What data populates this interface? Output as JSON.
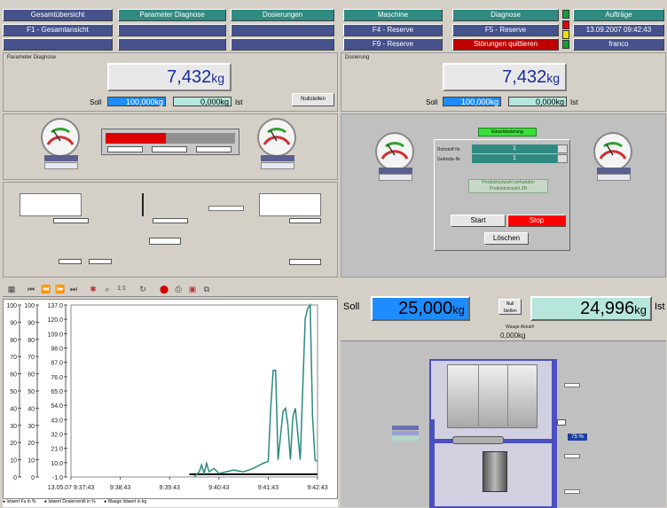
{
  "topnav": {
    "col1": [
      "Gesamtübersicht",
      "F1 - Gesamtansicht"
    ],
    "col2": [
      "Parameter Diagnose"
    ],
    "col3": [
      "Dosierungen"
    ],
    "col4": [
      "Maschine",
      "F4 - Reserve",
      "F9 - Reserve"
    ],
    "col5": [
      "Diagnose",
      "F5 - Reserve",
      "Störungen quittieren"
    ],
    "col6": [
      "Aufträge",
      "13.09.2007 09:42:43",
      "franco"
    ]
  },
  "left_panel": {
    "title": "Parameter Diagnose",
    "weight_value": "7,432",
    "weight_unit": "kg",
    "soll_label": "Soll",
    "soll_value": "100,000",
    "soll_unit": "kg",
    "ist_value": "0,000",
    "ist_unit": "kg",
    "ist_label": "Ist",
    "nullstellen": "Nullstellen"
  },
  "right_panel": {
    "title": "Dosierung",
    "weight_value": "7,432",
    "weight_unit": "kg",
    "soll_label": "Soll",
    "soll_value": "100,000",
    "soll_unit": "kg",
    "ist_value": "0,000",
    "ist_unit": "kg",
    "ist_label": "Ist",
    "einzel_label": "Einzeldosierung",
    "rohstoff_label": "Rohstoff-Nr.",
    "rohstoff_value": "1",
    "gebinde_label": "Gebinde-Nr.",
    "gebinde_value": "1",
    "produkt_line1": "Produktvorwahl vorhanden",
    "produkt_line2": "Produktvorwahl ZR",
    "start": "Start",
    "stop": "Stop",
    "loeschen": "Löschen"
  },
  "bottom_right": {
    "soll_label": "Soll",
    "soll_value": "25,000",
    "soll_unit": "kg",
    "null_btn": "Null Stellen",
    "ist_value": "24,996",
    "ist_unit": "kg",
    "ist_label": "Ist",
    "waage_label": "Waage Aktuell",
    "waage_value": "0,000kg",
    "pct_value": "75 %"
  },
  "chart_data": {
    "type": "line",
    "y_axes": [
      {
        "ticks": [
          "100",
          "90",
          "80",
          "70",
          "60",
          "50",
          "40",
          "30",
          "20",
          "10",
          "0"
        ]
      },
      {
        "ticks": [
          "100",
          "90",
          "80",
          "70",
          "60",
          "50",
          "40",
          "30",
          "20",
          "10",
          "0"
        ]
      },
      {
        "ticks": [
          "137.0",
          "120.0",
          "109.0",
          "98.0",
          "87.0",
          "76.0",
          "65.0",
          "54.0",
          "43.0",
          "32.0",
          "21.0",
          "10.0",
          "-1.0"
        ]
      }
    ],
    "x_ticks": [
      "13.05.07 9:37:43",
      "9:38:43",
      "9:39:43",
      "9:40:43",
      "9:41:43",
      "9:42:43"
    ],
    "ylim": [
      -1,
      137
    ],
    "series": [
      {
        "color": "#2a8a80",
        "x": [
          0.5,
          0.52,
          0.53,
          0.54,
          0.55,
          0.56,
          0.58,
          0.6,
          0.66,
          0.7,
          0.74,
          0.78,
          0.8,
          0.81,
          0.82,
          0.83,
          0.84,
          0.86,
          0.87,
          0.88,
          0.89,
          0.9,
          0.91,
          0.93,
          0.95,
          0.96,
          0.97,
          0.98,
          0.99,
          1.0
        ],
        "y": [
          0,
          3,
          7,
          2,
          8,
          3,
          5,
          2,
          4,
          3,
          5,
          8,
          9,
          40,
          62,
          62,
          10,
          38,
          40,
          30,
          10,
          35,
          40,
          10,
          92,
          98,
          100,
          35,
          10,
          9
        ]
      }
    ],
    "legend": [
      "Istwert Fu in %",
      "Istwert Dosierventil in %",
      "Waage Istwert in kg"
    ]
  }
}
